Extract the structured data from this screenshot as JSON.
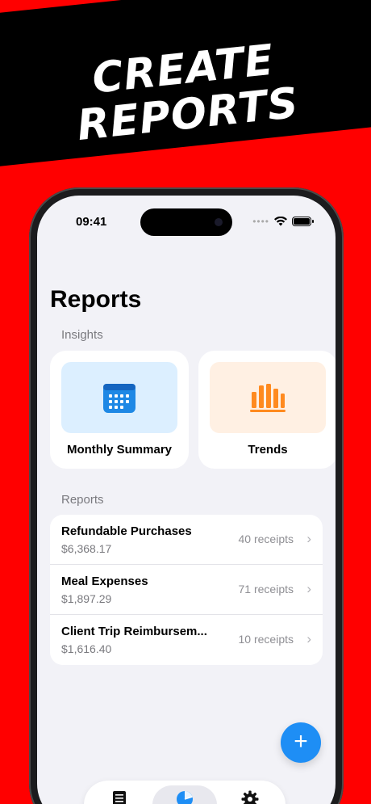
{
  "promo": {
    "line1": "CREATE",
    "line2": "REPORTS"
  },
  "status_bar": {
    "time": "09:41",
    "signal_dots": "••••"
  },
  "page": {
    "title": "Reports"
  },
  "insights": {
    "section_label": "Insights",
    "cards": [
      {
        "label": "Monthly Summary",
        "icon": "calendar-icon",
        "tile_color": "#dcefff",
        "icon_color": "#1e88e5"
      },
      {
        "label": "Trends",
        "icon": "bar-chart-icon",
        "tile_color": "#fff0e3",
        "icon_color": "#ff8a1f"
      }
    ]
  },
  "reports": {
    "section_label": "Reports",
    "items": [
      {
        "name": "Refundable Purchases",
        "amount": "$6,368.17",
        "count": "40 receipts"
      },
      {
        "name": "Meal Expenses",
        "amount": "$1,897.29",
        "count": "71 receipts"
      },
      {
        "name": "Client Trip Reimbursem...",
        "amount": "$1,616.40",
        "count": "10 receipts"
      }
    ]
  },
  "fab": {
    "label": "+"
  },
  "tab_bar": {
    "tabs": [
      "receipts-icon",
      "pie-chart-icon",
      "gear-icon"
    ],
    "active_tab": "pie-chart-icon"
  },
  "colors": {
    "background": "#ff0000",
    "accent": "#1e8ef5",
    "banner": "#000000"
  }
}
